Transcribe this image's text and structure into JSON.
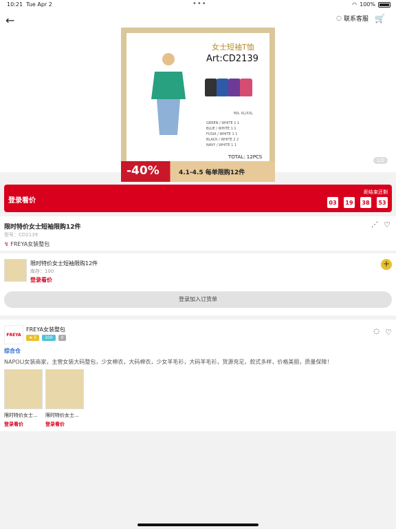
{
  "status": {
    "time": "10:21",
    "date": "Tue Apr 2",
    "battery": "100%",
    "dots": "•••"
  },
  "header": {
    "service_label": "联系客服"
  },
  "product_image": {
    "title": "女士短袖T恤",
    "art": "Art:CD2139",
    "sizes_header": "M/L    XL/XXL",
    "rows": [
      "GREEN / WHITE      1      1",
      "BLUE /  WHITE      1      1",
      "FUSIA / WHITE      1      1",
      "BLACK / WHITE      2      2",
      "NAVY /  WHITE      1      1"
    ],
    "total": "TOTAL: 12PCS",
    "discount": "-40%",
    "promo": "4.1-4.5    每单限购12件",
    "pager": "1/2"
  },
  "promo_bar": {
    "login": "登录看价",
    "until": "距结束还剩",
    "timer": [
      "03",
      "19",
      "38",
      "53"
    ]
  },
  "info": {
    "name": "限时特价女士短袖限购12件",
    "model": "型号：CD2139",
    "brand": "FREYA女装整包"
  },
  "sku": {
    "title": "限时特价女士短袖限购12件",
    "stock": "库存：100",
    "price": "登录看价",
    "add_cart": "登录加入订货单"
  },
  "store": {
    "logo": "FREYA",
    "name": "FREYA女装整包",
    "badges": [
      "★ 5",
      "100",
      "0"
    ],
    "category": "综合仓",
    "desc": "NAPOLI女装商家，主营女装大码整包，少女棉衣，大码棉衣，少女羊毛衫，大码羊毛衫，货源充足，款式多样，价格美丽，质量保障！",
    "items": [
      {
        "label": "限时特价女士...",
        "price": "登录看价"
      },
      {
        "label": "限时特价女士...",
        "price": "登录看价"
      }
    ]
  }
}
